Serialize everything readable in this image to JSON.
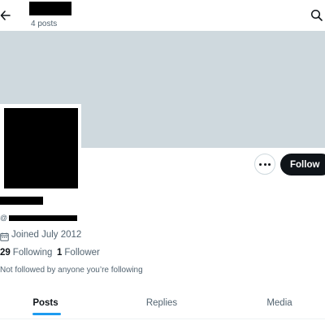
{
  "header": {
    "posts_count": "4 posts"
  },
  "profile": {
    "at_sign": "@",
    "joined": "Joined July 2012",
    "following_count": "29",
    "following_label": "Following",
    "followers_count": "1",
    "followers_label": "Follower",
    "followed_note": "Not followed by anyone you’re following"
  },
  "actions": {
    "follow_label": "Follow"
  },
  "tabs": [
    {
      "label": "Posts",
      "active": true
    },
    {
      "label": "Replies",
      "active": false
    },
    {
      "label": "Media",
      "active": false
    }
  ],
  "colors": {
    "banner": "#cfd9de",
    "follow_button": "#0f1419",
    "active_tab_indicator": "#1d9bf0",
    "secondary_text": "#536471"
  },
  "icons": {
    "back": "back-arrow-icon",
    "search": "search-icon",
    "more": "more-dots-icon",
    "calendar": "calendar-icon"
  }
}
